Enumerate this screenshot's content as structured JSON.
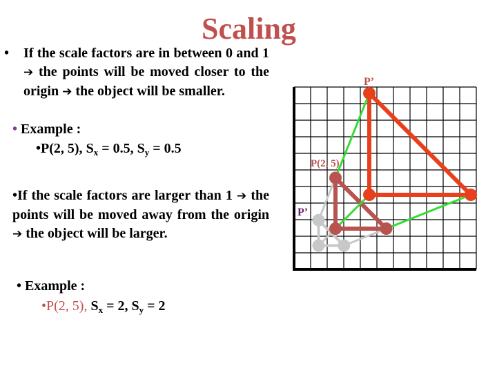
{
  "title": "Scaling",
  "section1": {
    "bullet": "•",
    "text_parts": [
      "If the scale factors are in between 0 and 1 ",
      " the points will be moved closer to the origin ",
      " the object will be smaller."
    ],
    "arrow_icon": "➔",
    "example_label": "Example :",
    "example_bullet": "•",
    "example": {
      "point": "P(2, 5), ",
      "sx_label": "S",
      "sx_sub": "x",
      "sx_value": " = 0.5, ",
      "sy_label": "S",
      "sy_sub": "y",
      "sy_value": " = 0.5"
    }
  },
  "section2": {
    "text_parts": [
      "•If the scale factors are larger than 1 ",
      " the points will be moved away from the origin ",
      " the object will be larger."
    ],
    "arrow_icon": "➔",
    "example_label": "• Example :",
    "example": {
      "point": "•P(2, 5), ",
      "sx_label": "S",
      "sx_sub": "x",
      "sx_value": " = 2, ",
      "sy_label": "S",
      "sy_sub": "y",
      "sy_value": " = 2"
    }
  },
  "diagram": {
    "grid_cells": 11,
    "original_triangle": [
      [
        2,
        5
      ],
      [
        2,
        2
      ],
      [
        5,
        2
      ]
    ],
    "scaled_down_triangle": [
      [
        1,
        2.5
      ],
      [
        1,
        1
      ],
      [
        2.5,
        1
      ]
    ],
    "scaled_up_triangle": [
      [
        4,
        10
      ],
      [
        4,
        4
      ],
      [
        10,
        4
      ]
    ],
    "labels": {
      "original": "P(2, 5)",
      "scaled_up": "P’",
      "scaled_down": "P’"
    },
    "colors": {
      "original": "#b85450",
      "scaled_up": "#e8401c",
      "scaled_down": "#c8c8c8",
      "connector": "#33dd33",
      "label_up": "#c0504d",
      "label_down": "#6b1f6b",
      "grid": "#000000"
    }
  }
}
